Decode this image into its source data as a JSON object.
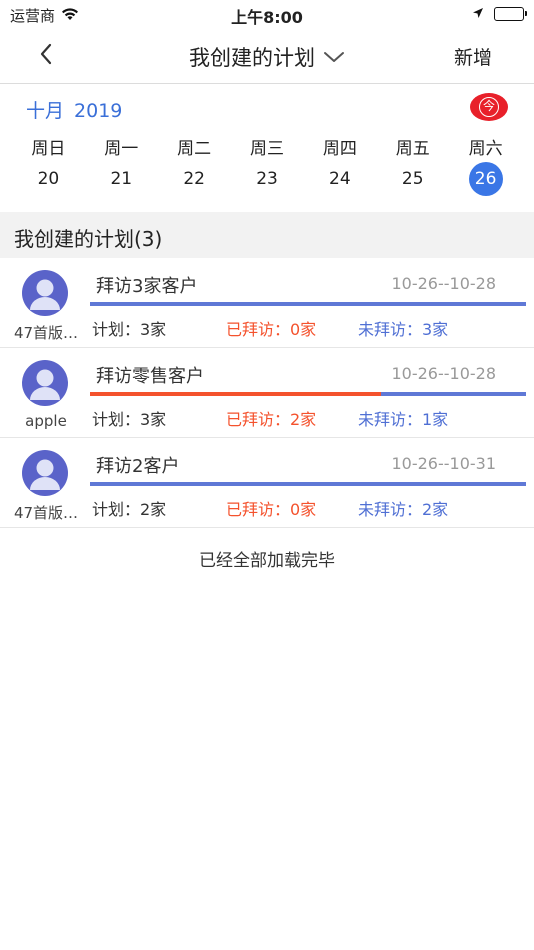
{
  "status_bar": {
    "carrier": "运营商",
    "time": "上午8:00",
    "icons": [
      "wifi-icon",
      "location-arrow-icon",
      "battery-icon"
    ]
  },
  "nav": {
    "title": "我创建的计划",
    "action": "新增",
    "icons": [
      "chevron-left-icon",
      "chevron-down-icon"
    ]
  },
  "calendar": {
    "month": "十月",
    "year": "2019",
    "today_label": "今",
    "weekdays": [
      "周日",
      "周一",
      "周二",
      "周三",
      "周四",
      "周五",
      "周六"
    ],
    "dates": [
      "20",
      "21",
      "22",
      "23",
      "24",
      "25",
      "26"
    ],
    "selected_date": "26"
  },
  "section": {
    "title": "我创建的计划(3)"
  },
  "plans": [
    {
      "owner": "47首版…",
      "name": "拜访3家客户",
      "range": "10-26--10-28",
      "plan_text": "计划：3家",
      "visited_text": "已拜访：0家",
      "unvisited_text": "未拜访：3家",
      "progress": 0
    },
    {
      "owner": "apple",
      "name": "拜访零售客户",
      "range": "10-26--10-28",
      "plan_text": "计划：3家",
      "visited_text": "已拜访：2家",
      "unvisited_text": "未拜访：1家",
      "progress": 0.667
    },
    {
      "owner": "47首版…",
      "name": "拜访2客户",
      "range": "10-26--10-31",
      "plan_text": "计划：2家",
      "visited_text": "已拜访：0家",
      "unvisited_text": "未拜访：2家",
      "progress": 0
    }
  ],
  "footer": {
    "load_complete": "已经全部加载完毕"
  },
  "colors": {
    "accent_blue": "#3a76e6",
    "visited_orange": "#f4522d",
    "unvisited_blue": "#4f6fd4",
    "avatar_purple": "#5a63c9",
    "today_red": "#e8202a"
  }
}
